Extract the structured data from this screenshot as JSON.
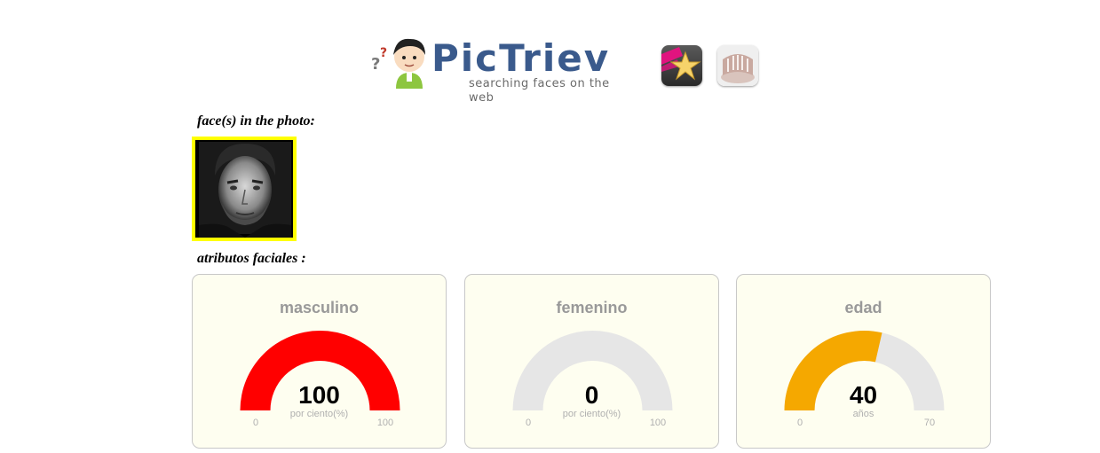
{
  "header": {
    "logo_title": "PicTriev",
    "logo_subtitle": "searching faces on the web",
    "app_icons": [
      {
        "name": "star-app-icon"
      },
      {
        "name": "library-app-icon"
      }
    ]
  },
  "faces_section": {
    "label": "face(s) in the photo:"
  },
  "attributes_section": {
    "label": "atributos faciales :"
  },
  "gauges": [
    {
      "title": "masculino",
      "value": "100",
      "level": 100,
      "unit": "por ciento(%)",
      "min": "0",
      "max": "100",
      "min_value": 0,
      "max_value": 100,
      "color": "#ff0000",
      "track_color": "#e6e6e6"
    },
    {
      "title": "femenino",
      "value": "0",
      "level": 0,
      "unit": "por ciento(%)",
      "min": "0",
      "max": "100",
      "min_value": 0,
      "max_value": 100,
      "color": "#ff0000",
      "track_color": "#e6e6e6"
    },
    {
      "title": "edad",
      "value": "40",
      "level": 40,
      "unit": "años",
      "min": "0",
      "max": "70",
      "min_value": 0,
      "max_value": 70,
      "color": "#f5a800",
      "track_color": "#e6e6e6"
    }
  ]
}
